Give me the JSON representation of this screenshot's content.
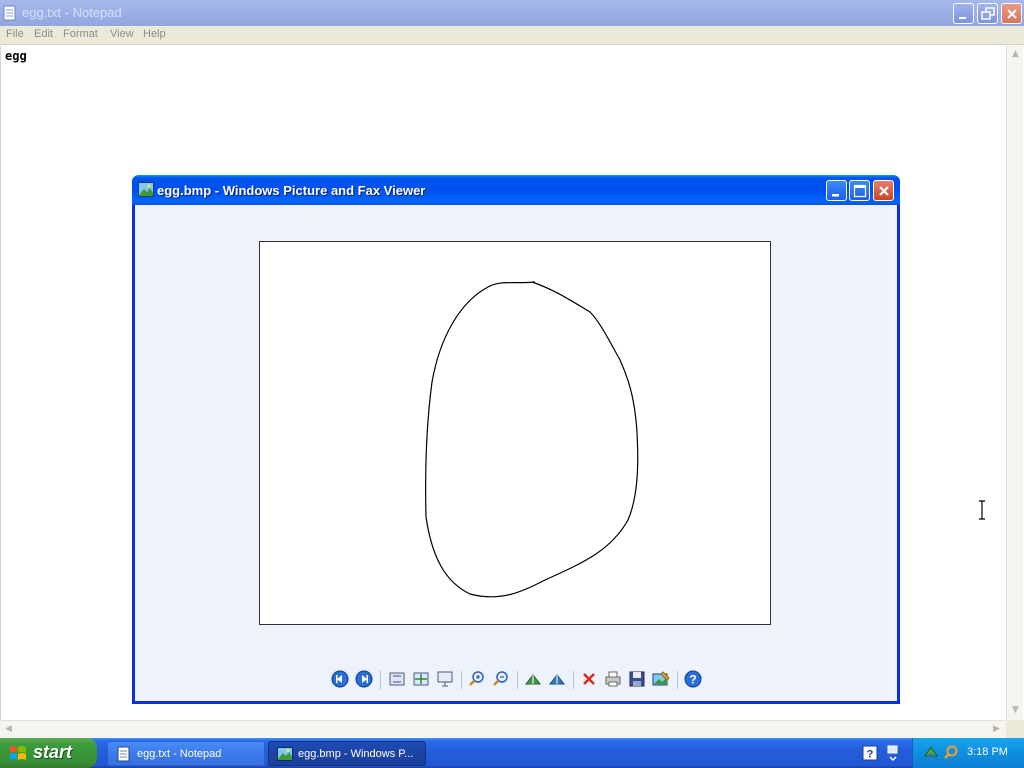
{
  "notepad": {
    "title": "egg.txt - Notepad",
    "menu": [
      "File",
      "Edit",
      "Format",
      "View",
      "Help"
    ],
    "content": "egg"
  },
  "viewer": {
    "title": "egg.bmp - Windows Picture and Fax Viewer",
    "toolbar_icons": [
      "previous-image-icon",
      "next-image-icon",
      "best-fit-icon",
      "actual-size-icon",
      "slideshow-icon",
      "zoom-in-icon",
      "zoom-out-icon",
      "rotate-clockwise-icon",
      "rotate-counterclockwise-icon",
      "delete-icon",
      "print-icon",
      "save-icon",
      "open-for-editing-icon",
      "help-icon"
    ]
  },
  "taskbar": {
    "start_label": "start",
    "tasks": [
      {
        "label": "egg.txt - Notepad",
        "active": false
      },
      {
        "label": "egg.bmp - Windows P...",
        "active": true
      }
    ],
    "clock": "3:18 PM"
  },
  "colors": {
    "active_title": "#0054e3",
    "inactive_title": "#9db1e8",
    "taskbar": "#245edb",
    "start_button": "#3c9c3b",
    "viewer_background": "#eef2fb"
  }
}
